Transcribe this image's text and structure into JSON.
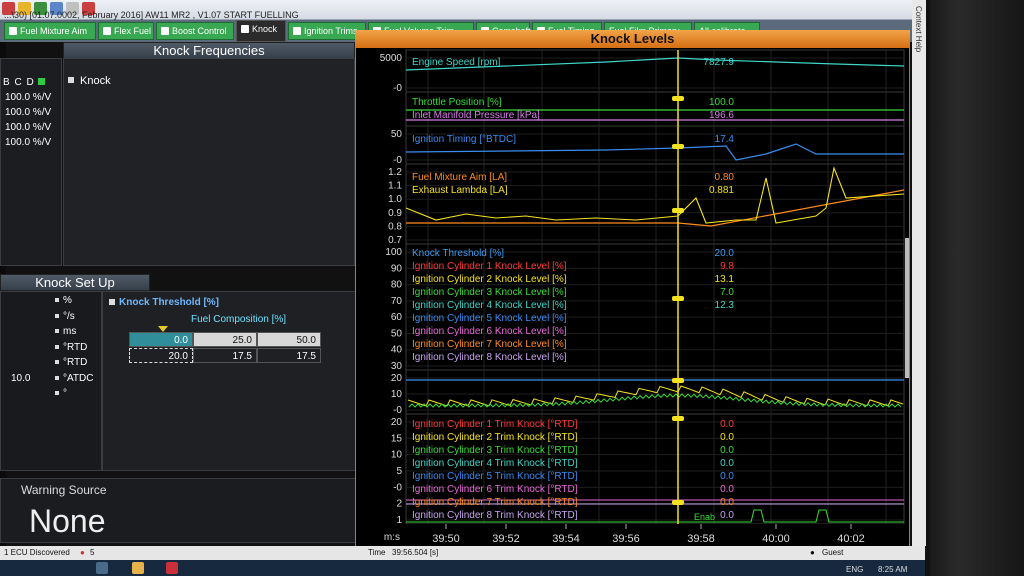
{
  "window": {
    "title": "...\\30) [01.07.0002, February 2016] AW11 MR2 , V1.07 START FUELLING"
  },
  "tabs": [
    {
      "label": "Fuel Mixture Aim",
      "active": false
    },
    {
      "label": "Flex Fuel",
      "active": false
    },
    {
      "label": "Boost Control",
      "active": false
    },
    {
      "label": "Knock",
      "active": true
    },
    {
      "label": "Ignition Trims",
      "active": false
    },
    {
      "label": "Fuel Volume Trim",
      "active": false
    },
    {
      "label": "Camshaft",
      "active": false
    },
    {
      "label": "Fuel Timing",
      "active": false
    },
    {
      "label": "Fuel Film Primary",
      "active": false
    },
    {
      "label": "All calibrate",
      "active": false
    }
  ],
  "knock_frequencies": {
    "title": "Knock Frequencies",
    "columns_label": "B C D",
    "rows": [
      "100.0  %/V",
      "100.0  %/V",
      "100.0  %/V",
      "100.0  %/V"
    ],
    "tree_item": "Knock"
  },
  "knock_setup": {
    "title": "Knock Set Up",
    "units": [
      {
        "value": "",
        "unit": "%"
      },
      {
        "value": "",
        "unit": "°/s"
      },
      {
        "value": "",
        "unit": "ms"
      },
      {
        "value": "",
        "unit": "°RTD"
      },
      {
        "value": "",
        "unit": "°RTD"
      },
      {
        "value": "10.0",
        "unit": "°ATDC"
      },
      {
        "value": "",
        "unit": "°"
      }
    ],
    "threshold_label": "Knock Threshold [%]",
    "fuel_composition_label": "Fuel Composition [%]",
    "table_header": [
      "0.0",
      "25.0",
      "50.0"
    ],
    "table_row": [
      "20.0",
      "17.5",
      "17.5"
    ]
  },
  "warning": {
    "label": "Warning Source",
    "value": "None"
  },
  "knock_levels": {
    "title": "Knock Levels",
    "speed": {
      "axis_labels": [
        "5000",
        "-0"
      ],
      "channels": [
        {
          "name": "Engine Speed [rpm]",
          "value": "7827.9",
          "color": "#3fd6c9"
        }
      ]
    },
    "throttle": {
      "channels": [
        {
          "name": "Throttle Position [%]",
          "value": "100.0",
          "color": "#3adb3a"
        },
        {
          "name": "Inlet Manifold Pressure [kPa]",
          "value": "196.6",
          "color": "#d77ee8"
        }
      ]
    },
    "ignition": {
      "axis_labels": [
        "50",
        "-0"
      ],
      "channels": [
        {
          "name": "Ignition Timing [°BTDC]",
          "value": "17.4",
          "color": "#3a8cf0"
        }
      ]
    },
    "lambda": {
      "axis_labels": [
        "1.2",
        "1.1",
        "1.0",
        "0.9",
        "0.8",
        "0.7"
      ],
      "channels": [
        {
          "name": "Fuel Mixture Aim [LA]",
          "value": "0.80",
          "color": "#ff8c1a"
        },
        {
          "name": "Exhaust Lambda [LA]",
          "value": "0.881",
          "color": "#f5e21f"
        }
      ]
    },
    "knock_level": {
      "axis_labels": [
        "100",
        "90",
        "80",
        "70",
        "60",
        "50",
        "40",
        "30"
      ],
      "channels": [
        {
          "name": "Knock Threshold [%]",
          "value": "20.0",
          "color": "#3a9cf0"
        },
        {
          "name": "Ignition Cylinder 1 Knock Level [%]",
          "value": "9.8",
          "color": "#ff3a3a"
        },
        {
          "name": "Ignition Cylinder 2 Knock Level [%]",
          "value": "13.1",
          "color": "#f5e21f"
        },
        {
          "name": "Ignition Cylinder 3 Knock Level [%]",
          "value": "7.0",
          "color": "#3adb3a"
        },
        {
          "name": "Ignition Cylinder 4 Knock Level [%]",
          "value": "12.3",
          "color": "#3fd6c9"
        },
        {
          "name": "Ignition Cylinder 5 Knock Level [%]",
          "value": "",
          "color": "#3a8cf0"
        },
        {
          "name": "Ignition Cylinder 6 Knock Level [%]",
          "value": "",
          "color": "#e86ad8"
        },
        {
          "name": "Ignition Cylinder 7 Knock Level [%]",
          "value": "",
          "color": "#ff8c1a"
        },
        {
          "name": "Ignition Cylinder 8 Knock Level [%]",
          "value": "",
          "color": "#c9a6f0"
        }
      ]
    },
    "knock_zoom": {
      "axis_labels": [
        "20",
        "10",
        "-0"
      ]
    },
    "trim": {
      "axis_labels": [
        "20",
        "15",
        "10",
        "5",
        "-0",
        "2",
        "1"
      ],
      "channels": [
        {
          "name": "Ignition Cylinder 1 Trim Knock [°RTD]",
          "value": "0.0",
          "color": "#ff3a3a"
        },
        {
          "name": "Ignition Cylinder 2 Trim Knock [°RTD]",
          "value": "0.0",
          "color": "#f5e21f"
        },
        {
          "name": "Ignition Cylinder 3 Trim Knock [°RTD]",
          "value": "0.0",
          "color": "#3adb3a"
        },
        {
          "name": "Ignition Cylinder 4 Trim Knock [°RTD]",
          "value": "0.0",
          "color": "#3fd6c9"
        },
        {
          "name": "Ignition Cylinder 5 Trim Knock [°RTD]",
          "value": "0.0",
          "color": "#3a8cf0"
        },
        {
          "name": "Ignition Cylinder 6 Trim Knock [°RTD]",
          "value": "0.0",
          "color": "#e86ad8"
        },
        {
          "name": "Ignition Cylinder 7 Trim Knock [°RTD]",
          "value": "0.0",
          "color": "#ff8c1a"
        },
        {
          "name": "Ignition Cylinder 8 Trim Knock [°RTD]",
          "value": "0.0",
          "color": "#c9a6f0"
        }
      ]
    },
    "time_axis": {
      "unit_label": "m:s",
      "ticks": [
        "39:50",
        "39:52",
        "39:54",
        "39:56",
        "39:58",
        "40:00",
        "40:02"
      ]
    },
    "cursor_color": "#f5e21f",
    "enable_label": "Enab"
  },
  "status": {
    "ecu": "1 ECU Discovered",
    "errors": "5",
    "time_label": "Time",
    "time_value": "39:56.504 [s]",
    "user": "Guest"
  },
  "taskbar": {
    "lang": "ENG",
    "clock": "8:25 AM"
  },
  "side_help": "Context Help"
}
